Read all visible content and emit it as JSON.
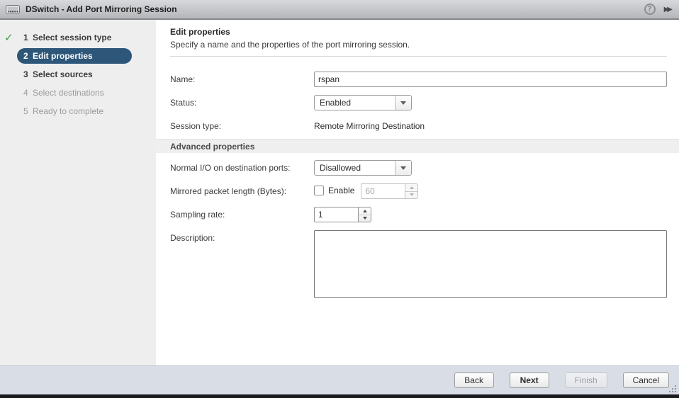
{
  "window": {
    "title": "DSwitch - Add Port Mirroring Session",
    "help_label": "?"
  },
  "sidebar": {
    "steps": [
      {
        "number": "1",
        "label": "Select session type",
        "state": "completed"
      },
      {
        "number": "2",
        "label": "Edit properties",
        "state": "active"
      },
      {
        "number": "3",
        "label": "Select sources",
        "state": "enabled"
      },
      {
        "number": "4",
        "label": "Select destinations",
        "state": "disabled"
      },
      {
        "number": "5",
        "label": "Ready to complete",
        "state": "disabled"
      }
    ]
  },
  "main": {
    "heading": "Edit properties",
    "subheading": "Specify a name and the properties of the port mirroring session.",
    "advanced_section_title": "Advanced properties",
    "fields": {
      "name": {
        "label": "Name:",
        "value": "rspan"
      },
      "status": {
        "label": "Status:",
        "value": "Enabled"
      },
      "session_type": {
        "label": "Session type:",
        "value": "Remote Mirroring Destination"
      },
      "normal_io": {
        "label": "Normal I/O on destination ports:",
        "value": "Disallowed"
      },
      "packet_length": {
        "label": "Mirrored packet length (Bytes):",
        "checkbox_label": "Enable",
        "checked": false,
        "value": "60"
      },
      "sampling_rate": {
        "label": "Sampling rate:",
        "value": "1"
      },
      "description": {
        "label": "Description:",
        "value": ""
      }
    }
  },
  "footer": {
    "buttons": [
      {
        "label": "Back",
        "state": "enabled"
      },
      {
        "label": "Next",
        "state": "primary"
      },
      {
        "label": "Finish",
        "state": "disabled"
      },
      {
        "label": "Cancel",
        "state": "enabled"
      }
    ]
  },
  "colors": {
    "active_step_bg": "#2d5679",
    "check_green": "#3da23d",
    "sidebar_bg": "#eeeeee",
    "footer_bg": "#d9dde5",
    "titlebar_top": "#d7d9dc",
    "titlebar_bottom": "#b4b6ba"
  }
}
